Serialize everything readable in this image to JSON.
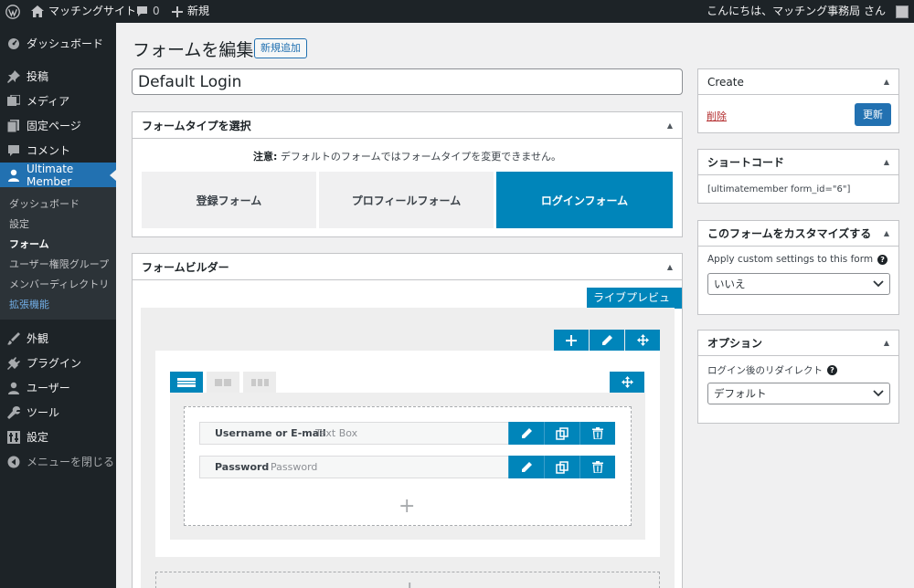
{
  "adminbar": {
    "site_name": "マッチングサイト",
    "comments_count": "0",
    "new_label": "新規",
    "greeting": "こんにちは、マッチング事務局 さん"
  },
  "sidebar": {
    "items": [
      {
        "label": "ダッシュボード",
        "icon": "dashboard-icon"
      },
      {
        "label": "投稿",
        "icon": "pin-icon"
      },
      {
        "label": "メディア",
        "icon": "media-icon"
      },
      {
        "label": "固定ページ",
        "icon": "page-icon"
      },
      {
        "label": "コメント",
        "icon": "comment-icon"
      },
      {
        "label": "Ultimate Member",
        "icon": "user-icon"
      },
      {
        "label": "外観",
        "icon": "appearance-icon"
      },
      {
        "label": "プラグイン",
        "icon": "plugin-icon"
      },
      {
        "label": "ユーザー",
        "icon": "users-icon"
      },
      {
        "label": "ツール",
        "icon": "wrench-icon"
      },
      {
        "label": "設定",
        "icon": "settings-icon"
      },
      {
        "label": "メニューを閉じる",
        "icon": "collapse-icon"
      }
    ],
    "submenu": [
      "ダッシュボード",
      "設定",
      "フォーム",
      "ユーザー権限グループ",
      "メンバーディレクトリ",
      "拡張機能"
    ]
  },
  "page": {
    "title": "フォームを編集",
    "add_new": "新規追加",
    "form_title": "Default Login"
  },
  "formtype": {
    "title": "フォームタイプを選択",
    "notice_bold": "注意:",
    "notice_text": " デフォルトのフォームではフォームタイプを変更できません。",
    "types": [
      "登録フォーム",
      "プロフィールフォーム",
      "ログインフォーム"
    ],
    "active_type": "ログインフォーム"
  },
  "builder": {
    "title": "フォームビルダー",
    "live_preview": "ライブプレビュー",
    "fields": [
      {
        "label": "Username or E-mail",
        "type": "Text Box"
      },
      {
        "label": "Password",
        "type": "Password"
      }
    ]
  },
  "create": {
    "title": "Create",
    "delete": "削除",
    "update": "更新"
  },
  "shortcode": {
    "title": "ショートコード",
    "code": "[ultimatemember form_id=\"6\"]"
  },
  "customize": {
    "title": "このフォームをカスタマイズする",
    "label": "Apply custom settings to this form",
    "value": "いいえ"
  },
  "options": {
    "title": "オプション",
    "label": "ログイン後のリダイレクト",
    "value": "デフォルト"
  },
  "colors": {
    "accent": "#0085ba",
    "wp_blue": "#2271b1",
    "sidebar_bg": "#1d2327",
    "delete_red": "#b32d2e"
  }
}
